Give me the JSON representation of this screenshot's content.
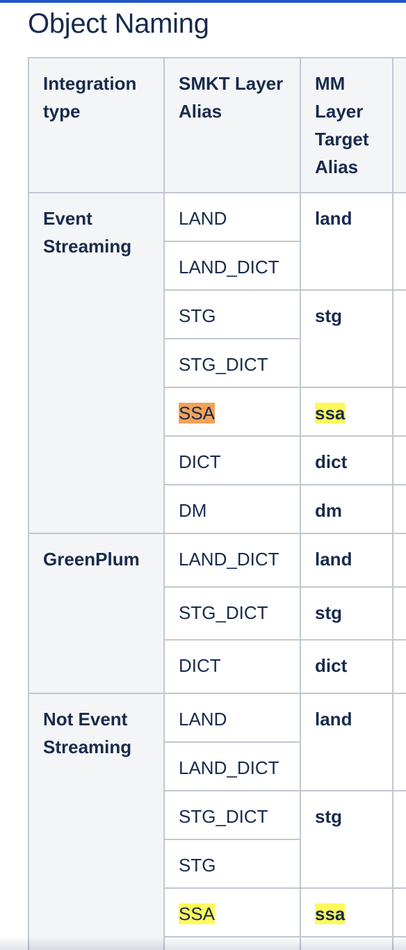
{
  "page": {
    "title": "Object Naming"
  },
  "table": {
    "headers": {
      "integration_type": "Integration type",
      "smkt_layer_alias": "SMKT Layer Alias",
      "mm_layer_target_alias": "MM Layer Target Alias"
    },
    "groups": [
      {
        "name": "Event Streaming",
        "smkt": [
          "LAND",
          "LAND_DICT",
          "STG",
          "STG_DICT",
          "SSA",
          "DICT",
          "DM"
        ],
        "mm": [
          "land",
          "stg",
          "ssa",
          "dict",
          "dm"
        ]
      },
      {
        "name": "GreenPlum",
        "smkt": [
          "LAND_DICT",
          "STG_DICT",
          "DICT"
        ],
        "mm": [
          "land",
          "stg",
          "dict"
        ]
      },
      {
        "name": "Not Event Streaming",
        "smkt": [
          "LAND",
          "LAND_DICT",
          "STG_DICT",
          "STG",
          "SSA"
        ],
        "mm": [
          "land",
          "stg",
          "ssa"
        ]
      }
    ]
  },
  "colors": {
    "top_bar": "#1f56c4",
    "highlight_orange": "#f1a25a",
    "highlight_yellow": "#fdf95a",
    "header_background": "#f4f5f7",
    "border": "#c1c7d0"
  }
}
